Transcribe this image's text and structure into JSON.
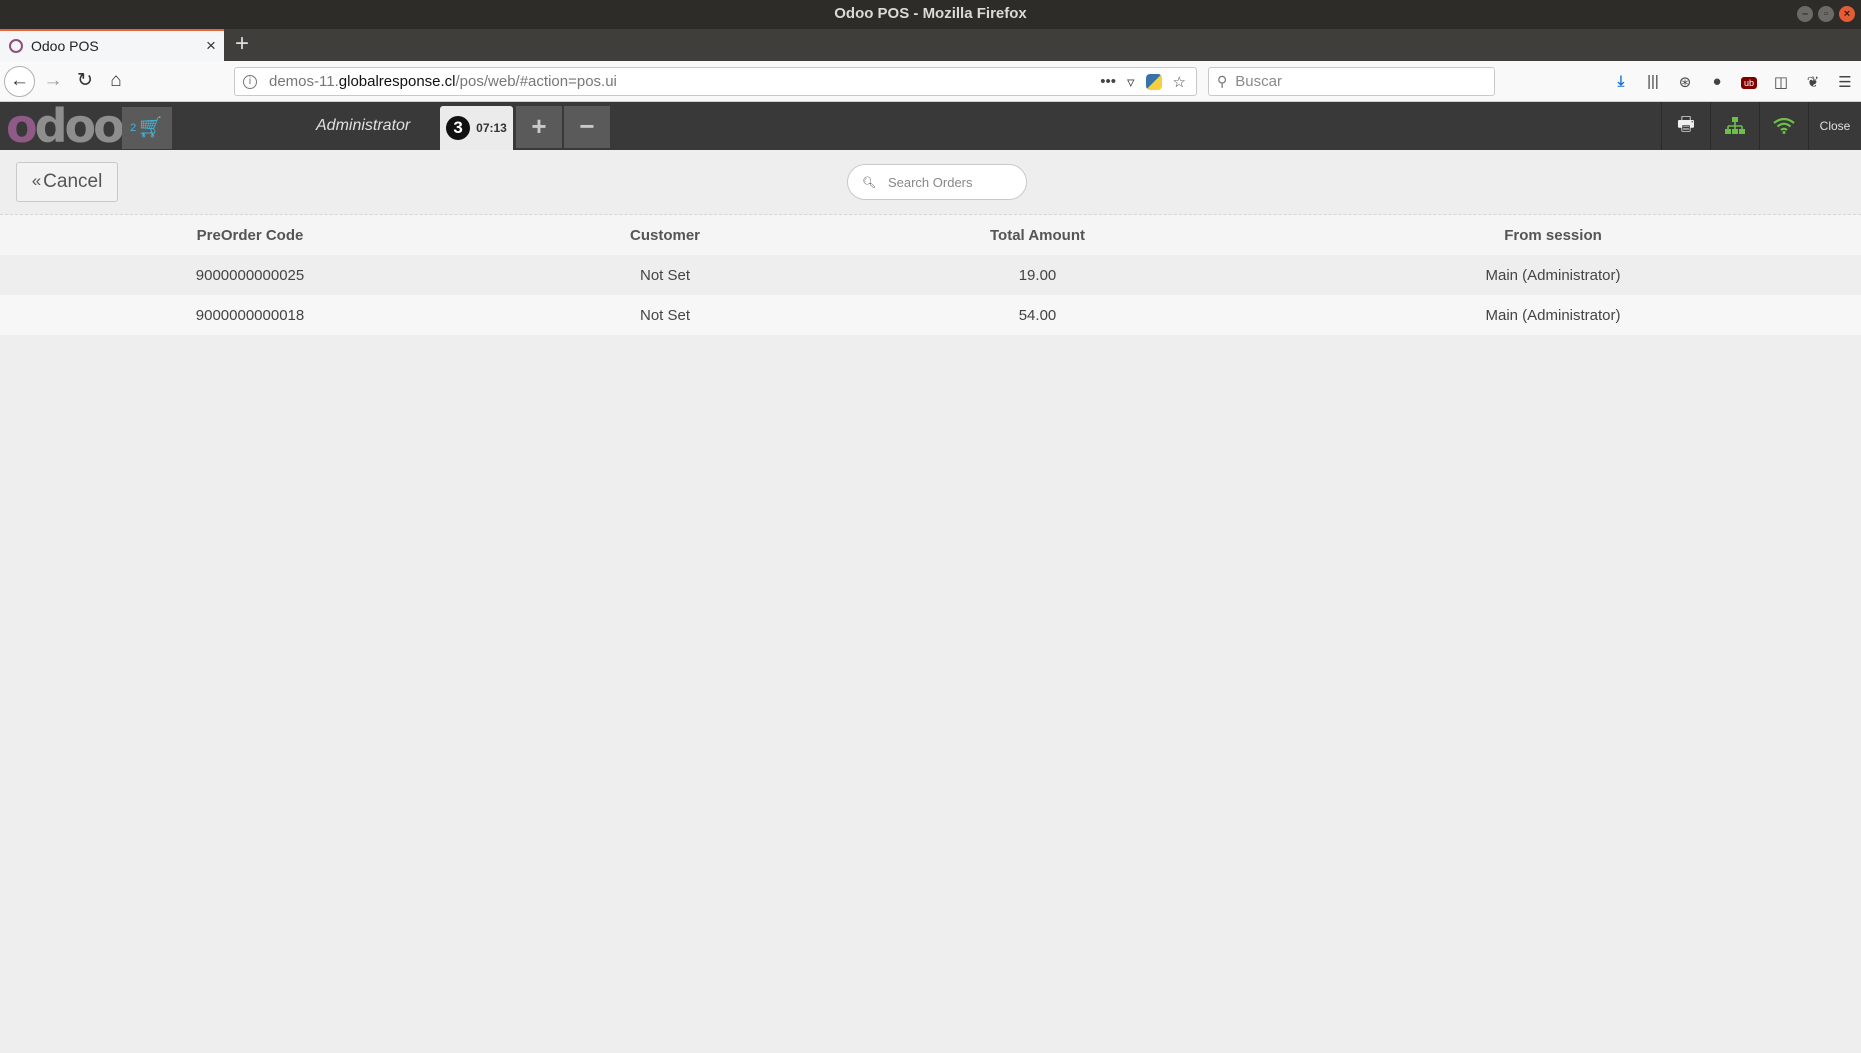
{
  "window": {
    "title": "Odoo POS - Mozilla Firefox"
  },
  "browser": {
    "tab_title": "Odoo POS",
    "url_prefix": "demos-11.",
    "url_host": "globalresponse.cl",
    "url_path": "/pos/web/#action=pos.ui",
    "search_placeholder": "Buscar"
  },
  "pos": {
    "logo": {
      "first": "o",
      "rest": "doo"
    },
    "cart_count": "2",
    "cashier": "Administrator",
    "order_number": "3",
    "order_time": "07:13",
    "add_label": "+",
    "remove_label": "−",
    "close_label": "Close",
    "status_colors": {
      "ok": "#6cc04a",
      "accent": "#8f5a85",
      "cart": "#44b6da"
    }
  },
  "orders_screen": {
    "cancel_label": "Cancel",
    "search_placeholder": "Search Orders",
    "columns": [
      "PreOrder Code",
      "Customer",
      "Total Amount",
      "From session"
    ],
    "rows": [
      {
        "code": "9000000000025",
        "customer": "Not Set",
        "total": "19.00",
        "session": "Main (Administrator)"
      },
      {
        "code": "9000000000018",
        "customer": "Not Set",
        "total": "54.00",
        "session": "Main (Administrator)"
      }
    ]
  }
}
